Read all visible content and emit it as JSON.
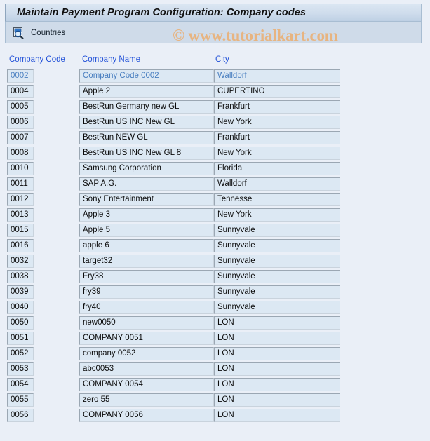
{
  "window": {
    "title": "Maintain Payment Program Configuration: Company codes"
  },
  "toolbar": {
    "countries_label": "Countries",
    "countries_icon": "search-document-icon"
  },
  "watermark": {
    "text": "© www.tutorialkart.com",
    "color": "#e7b481"
  },
  "table": {
    "columns": [
      {
        "key": "code",
        "label": "Company Code"
      },
      {
        "key": "name",
        "label": "Company Name"
      },
      {
        "key": "city",
        "label": "City"
      }
    ],
    "header_color": "#1f4fd8",
    "rows": [
      {
        "code": "0002",
        "name": "Company Code 0002",
        "city": "Walldorf",
        "readonly": true
      },
      {
        "code": "0004",
        "name": "Apple 2",
        "city": "CUPERTINO",
        "readonly": false
      },
      {
        "code": "0005",
        "name": "BestRun Germany new GL",
        "city": "Frankfurt",
        "readonly": false
      },
      {
        "code": "0006",
        "name": "BestRun US INC New GL",
        "city": "New York",
        "readonly": false
      },
      {
        "code": "0007",
        "name": "BestRun NEW GL",
        "city": "Frankfurt",
        "readonly": false
      },
      {
        "code": "0008",
        "name": "BestRun US INC New GL 8",
        "city": "New York",
        "readonly": false
      },
      {
        "code": "0010",
        "name": "Samsung Corporation",
        "city": "Florida",
        "readonly": false
      },
      {
        "code": "0011",
        "name": "SAP A.G.",
        "city": "Walldorf",
        "readonly": false
      },
      {
        "code": "0012",
        "name": "Sony Entertainment",
        "city": "Tennesse",
        "readonly": false
      },
      {
        "code": "0013",
        "name": "Apple 3",
        "city": "New York",
        "readonly": false
      },
      {
        "code": "0015",
        "name": "Apple 5",
        "city": "Sunnyvale",
        "readonly": false
      },
      {
        "code": "0016",
        "name": "apple 6",
        "city": "Sunnyvale",
        "readonly": false
      },
      {
        "code": "0032",
        "name": "target32",
        "city": "Sunnyvale",
        "readonly": false
      },
      {
        "code": "0038",
        "name": "Fry38",
        "city": "Sunnyvale",
        "readonly": false
      },
      {
        "code": "0039",
        "name": "fry39",
        "city": "Sunnyvale",
        "readonly": false
      },
      {
        "code": "0040",
        "name": "fry40",
        "city": "Sunnyvale",
        "readonly": false
      },
      {
        "code": "0050",
        "name": "new0050",
        "city": "LON",
        "readonly": false
      },
      {
        "code": "0051",
        "name": "COMPANY 0051",
        "city": "LON",
        "readonly": false
      },
      {
        "code": "0052",
        "name": "company 0052",
        "city": "LON",
        "readonly": false
      },
      {
        "code": "0053",
        "name": "abc0053",
        "city": "LON",
        "readonly": false
      },
      {
        "code": "0054",
        "name": "COMPANY 0054",
        "city": "LON",
        "readonly": false
      },
      {
        "code": "0055",
        "name": "zero 55",
        "city": "LON",
        "readonly": false
      },
      {
        "code": "0056",
        "name": "COMPANY 0056",
        "city": "LON",
        "readonly": false
      }
    ]
  }
}
